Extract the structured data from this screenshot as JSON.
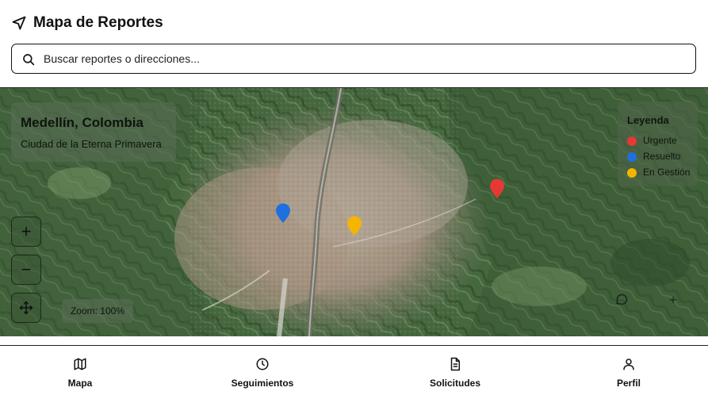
{
  "header": {
    "title": "Mapa de Reportes",
    "icon": "navigation-arrow-icon"
  },
  "search": {
    "placeholder": "Buscar reportes o direcciones...",
    "value": "",
    "icon": "search-icon"
  },
  "map": {
    "location_title": "Medellín, Colombia",
    "location_subtitle": "Ciudad de la Eterna Primavera",
    "zoom_label": "Zoom: 100%",
    "controls": {
      "zoom_in": "+",
      "zoom_out": "−",
      "pan_icon": "move-arrows-icon"
    },
    "legend": {
      "title": "Leyenda",
      "items": [
        {
          "label": "Urgente",
          "color": "#e53935"
        },
        {
          "label": "Resuelto",
          "color": "#1e6fe0"
        },
        {
          "label": "En Gestión",
          "color": "#f4b400"
        }
      ]
    },
    "markers": [
      {
        "status": "Urgente",
        "color": "#e53935"
      },
      {
        "status": "Resuelto",
        "color": "#1e6fe0"
      },
      {
        "status": "En Gestión",
        "color": "#f4b400"
      }
    ]
  },
  "bottom_nav": {
    "tabs": [
      {
        "label": "Mapa",
        "icon": "map-icon"
      },
      {
        "label": "Seguimientos",
        "icon": "clock-icon"
      },
      {
        "label": "Solicitudes",
        "icon": "document-icon"
      },
      {
        "label": "Perfil",
        "icon": "user-icon"
      }
    ]
  }
}
